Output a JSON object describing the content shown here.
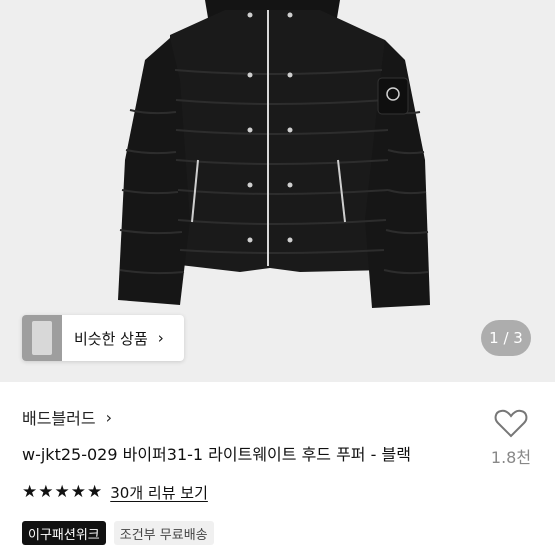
{
  "gallery": {
    "similar_label": "비슷한 상품",
    "similar_chevron": "›",
    "pager": "1 / 3"
  },
  "product": {
    "shop_name": "배드블러드",
    "shop_chevron": "›",
    "title": "w-jkt25-029 바이퍼31-1 라이트웨이트 후드 푸퍼 - 블랙",
    "like_count": "1.8천",
    "rating": 5,
    "stars": [
      "★",
      "★",
      "★",
      "★",
      "★"
    ],
    "review_link": "30개 리뷰 보기",
    "badges": [
      "이구패션위크",
      "조건부 무료배송"
    ]
  },
  "icons": {
    "heart": "heart-icon",
    "star": "star-icon",
    "chevron": "chevron-right-icon"
  },
  "colors": {
    "hero_bg": "#eeeeee",
    "text": "#111111",
    "muted": "#888888",
    "badge_dark": "#111111",
    "badge_light": "#f0f0f0"
  }
}
